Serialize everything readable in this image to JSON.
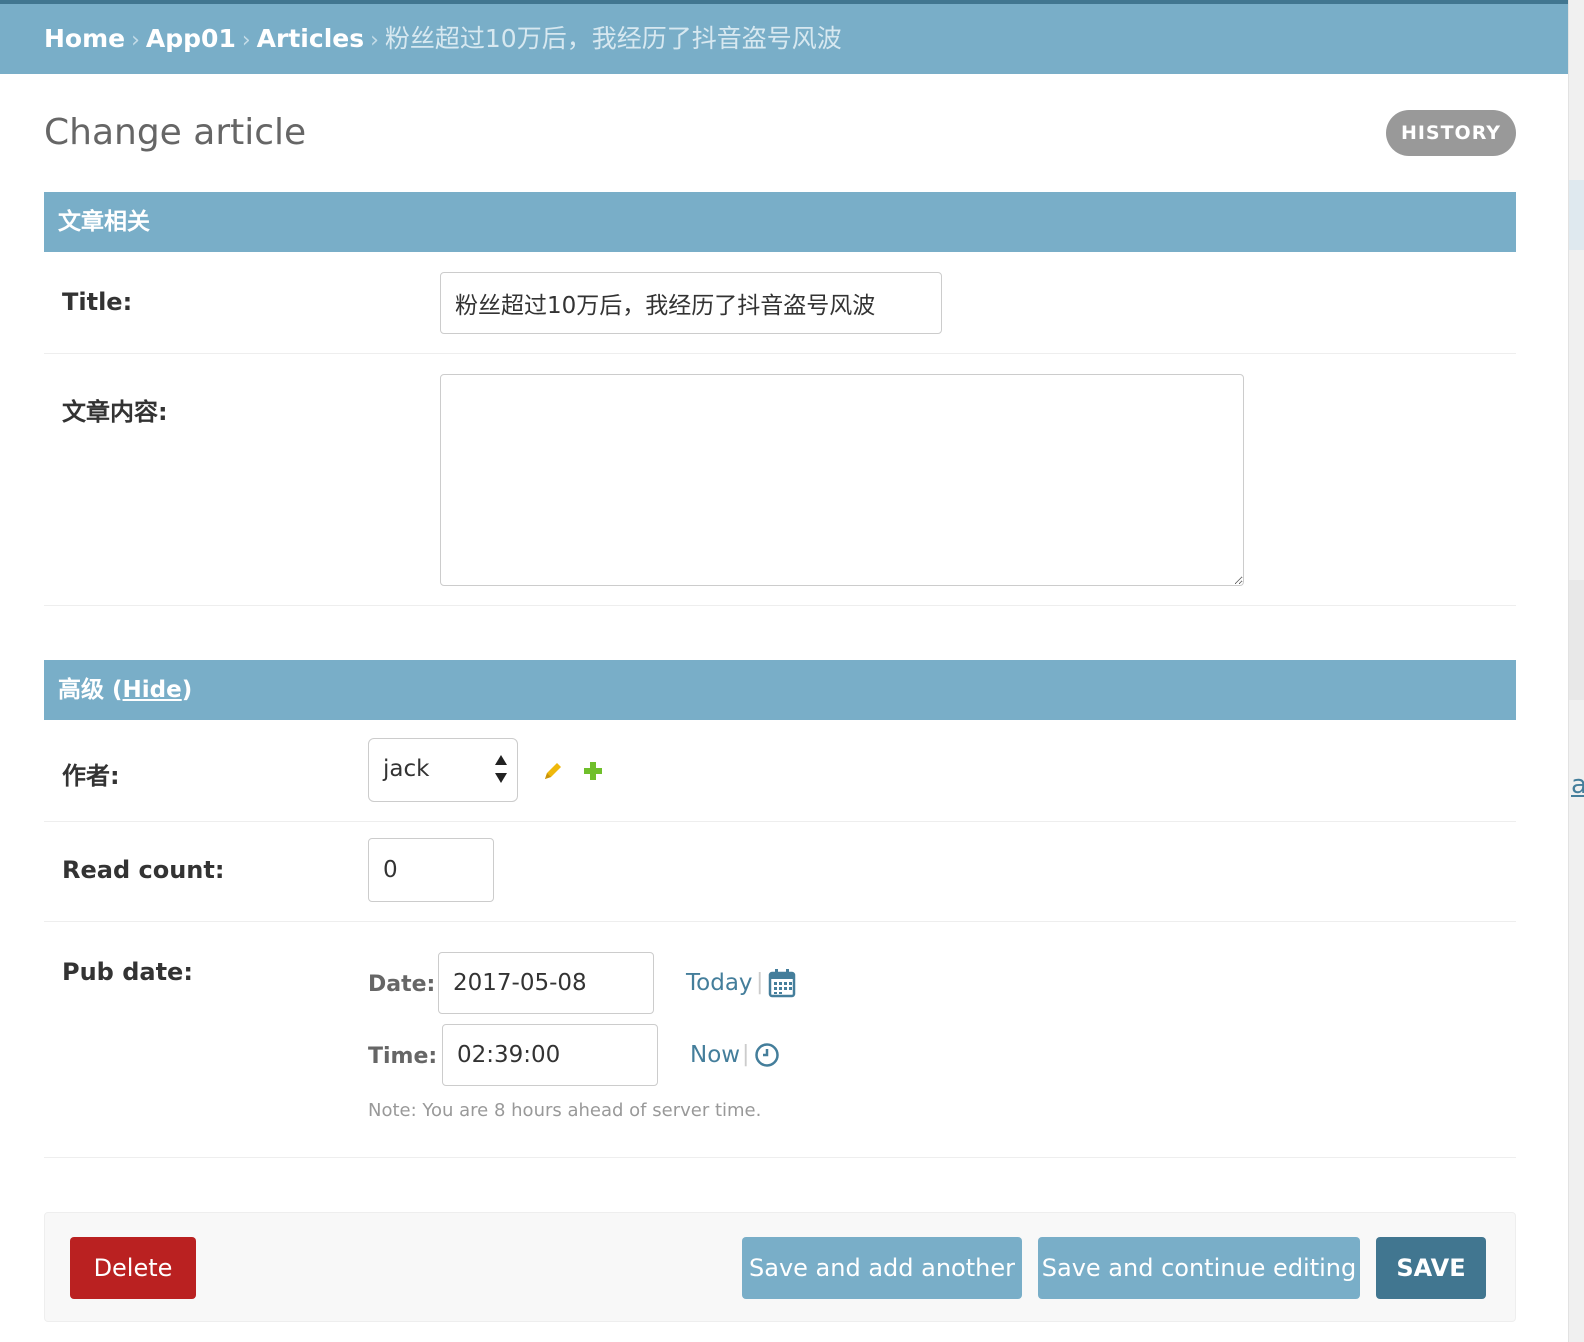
{
  "breadcrumbs": {
    "home": "Home",
    "app": "App01",
    "model": "Articles",
    "current": "粉丝超过10万后，我经历了抖音盗号风波",
    "separator": "›"
  },
  "page": {
    "title": "Change article",
    "history_label": "HISTORY"
  },
  "sections": {
    "article": {
      "title": "文章相关"
    },
    "advanced": {
      "title": "高级",
      "toggle_open": "(",
      "toggle_label": "Hide",
      "toggle_close": ")"
    }
  },
  "fields": {
    "title": {
      "label": "Title:",
      "value": "粉丝超过10万后，我经历了抖音盗号风波"
    },
    "content": {
      "label": "文章内容:",
      "value": ""
    },
    "author": {
      "label": "作者:",
      "value": "jack"
    },
    "read_count": {
      "label": "Read count:",
      "value": "0"
    },
    "pub_date": {
      "label": "Pub date:",
      "date_label": "Date:",
      "date_value": "2017-05-08",
      "today_label": "Today",
      "time_label": "Time:",
      "time_value": "02:39:00",
      "now_label": "Now",
      "pipe": "|",
      "note": "Note: You are 8 hours ahead of server time."
    }
  },
  "side_link": "a",
  "buttons": {
    "delete": "Delete",
    "save_add": "Save and add another",
    "save_continue": "Save and continue editing",
    "save": "SAVE"
  },
  "icons": {
    "edit": "pencil-icon",
    "add": "plus-icon",
    "calendar": "calendar-icon",
    "clock": "clock-icon"
  },
  "colors": {
    "header": "#79aec8",
    "header_dark": "#417690",
    "delete": "#ba2121",
    "link": "#447e9b"
  }
}
